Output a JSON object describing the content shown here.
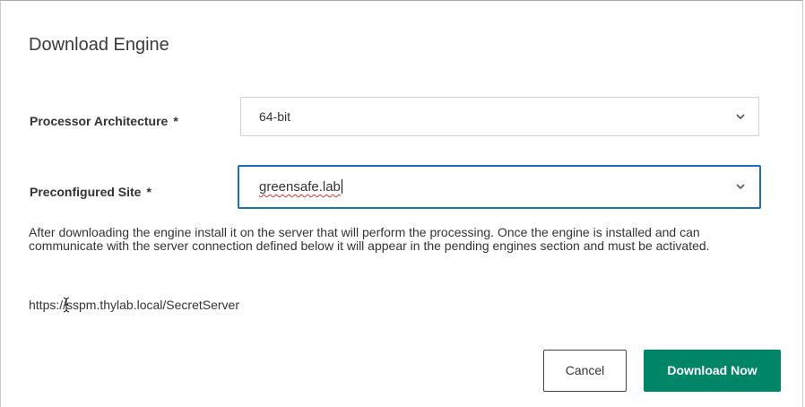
{
  "dialog": {
    "title": "Download Engine",
    "processor_architecture": {
      "label": "Processor Architecture",
      "required_marker": "*",
      "selected": "64-bit"
    },
    "preconfigured_site": {
      "label": "Preconfigured Site",
      "required_marker": "*",
      "selected": "greensafe.lab"
    },
    "help_text": "After downloading the engine install it on the server that will perform the processing. Once the engine is installed and can communicate with the server connection defined below it will appear in the pending engines section and must be activated.",
    "server_url": "https://sspm.thylab.local/SecretServer",
    "buttons": {
      "cancel": "Cancel",
      "download": "Download Now"
    }
  },
  "colors": {
    "primary_button": "#008566",
    "focus_border": "#1d6fb8"
  },
  "icons": {
    "dropdown": "chevron-down-icon",
    "cursor": "text-cursor-icon"
  }
}
